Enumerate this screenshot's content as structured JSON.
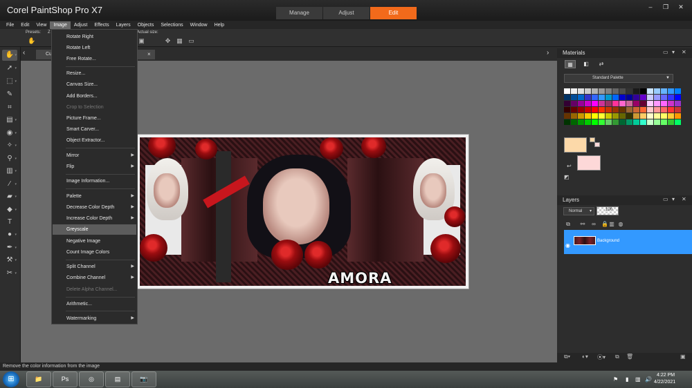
{
  "app": {
    "title": "Corel PaintShop Pro X7"
  },
  "workspace_tabs": [
    "Manage",
    "Adjust",
    "Edit"
  ],
  "window_controls": {
    "minimize": "–",
    "restore": "❐",
    "close": "✕"
  },
  "menubar": [
    "File",
    "Edit",
    "View",
    "Image",
    "Adjust",
    "Effects",
    "Layers",
    "Objects",
    "Selections",
    "Window",
    "Help"
  ],
  "tool_options": {
    "presets_label": "Presets:",
    "zoom_label_partial": "Z",
    "actual_size_label": "Actual size:"
  },
  "document_tab": {
    "label": "Cu",
    "close": "×"
  },
  "canvas_image": {
    "logo_text": "AMORA"
  },
  "image_menu": [
    {
      "label": "Rotate Right"
    },
    {
      "label": "Rotate Left"
    },
    {
      "label": "Free Rotate..."
    },
    {
      "label": "Resize..."
    },
    {
      "label": "Canvas Size..."
    },
    {
      "label": "Add Borders..."
    },
    {
      "label": "Crop to Selection"
    },
    {
      "label": "Picture Frame..."
    },
    {
      "label": "Smart Carver..."
    },
    {
      "label": "Object Extractor..."
    },
    {
      "label": "Mirror"
    },
    {
      "label": "Flip"
    },
    {
      "label": "Image Information..."
    },
    {
      "label": "Palette"
    },
    {
      "label": "Decrease Color Depth"
    },
    {
      "label": "Increase Color Depth"
    },
    {
      "label": "Greyscale"
    },
    {
      "label": "Negative Image"
    },
    {
      "label": "Count Image Colors"
    },
    {
      "label": "Split Channel"
    },
    {
      "label": "Combine Channel"
    },
    {
      "label": "Delete Alpha Channel..."
    },
    {
      "label": "Arithmetic..."
    },
    {
      "label": "Watermarking"
    }
  ],
  "materials": {
    "title": "Materials",
    "palette_select": "Standard Palette",
    "foreground_color": "#fcd9a9",
    "background_color": "#fdd8d8"
  },
  "layers": {
    "title": "Layers",
    "blend_mode": "Normal",
    "opacity": "100",
    "layer_name": "Background"
  },
  "status": {
    "text": "Remove the color information from the image"
  },
  "taskbar": {
    "time": "4:22 PM",
    "date": "4/22/2021"
  },
  "colors": {
    "accent": "#f26a1b",
    "selection": "#3399ff",
    "canvas_bg": "#6b6b6b"
  }
}
